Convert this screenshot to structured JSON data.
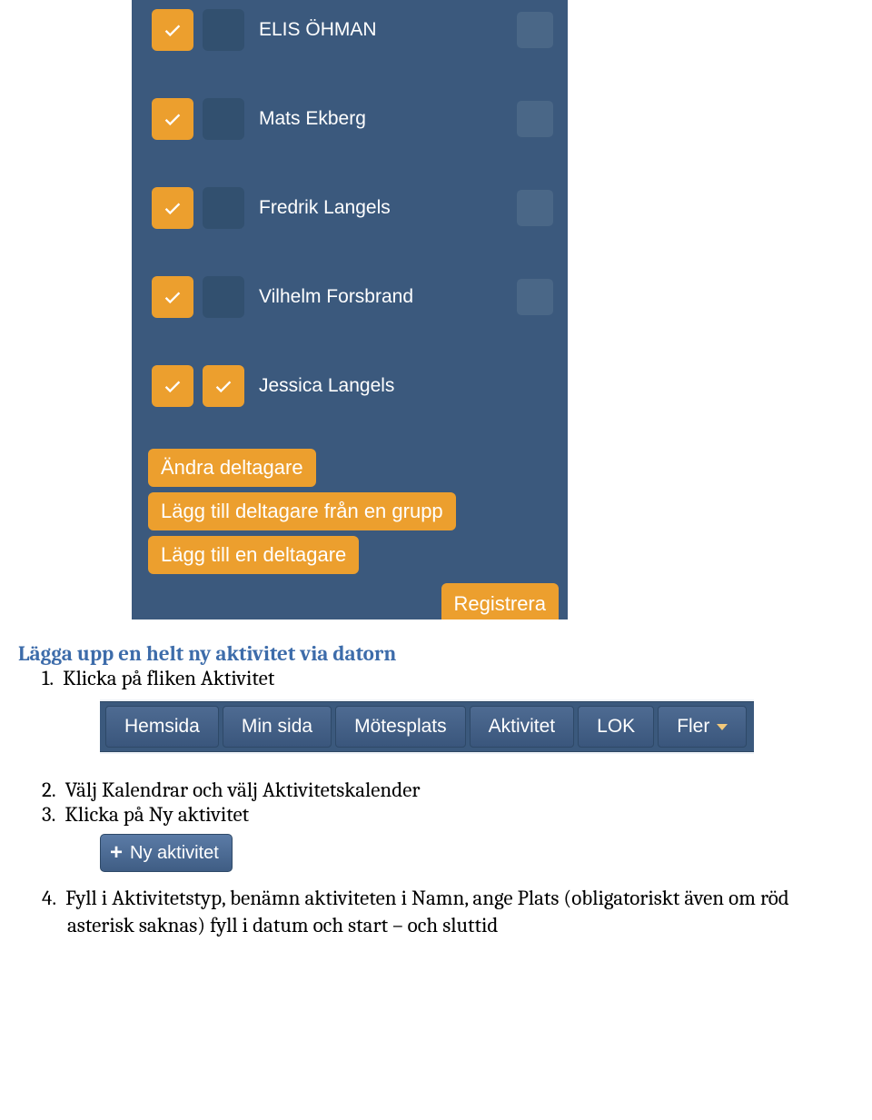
{
  "participants": [
    {
      "name": "ELIS ÖHMAN",
      "box1": true,
      "box2": false,
      "trailing": true
    },
    {
      "name": "Mats Ekberg",
      "box1": true,
      "box2": false,
      "trailing": true
    },
    {
      "name": "Fredrik Langels",
      "box1": true,
      "box2": false,
      "trailing": true
    },
    {
      "name": "Vilhelm Forsbrand",
      "box1": true,
      "box2": false,
      "trailing": true
    },
    {
      "name": "Jessica Langels",
      "box1": true,
      "box2": true,
      "trailing": false
    }
  ],
  "buttons": {
    "edit_participants": "Ändra deltagare",
    "add_from_group": "Lägg till deltagare från en grupp",
    "add_one": "Lägg till en deltagare",
    "register": "Registrera"
  },
  "section_heading": "Lägga upp en helt ny aktivitet via datorn",
  "steps": {
    "s1_num": "1.",
    "s1": "Klicka på fliken Aktivitet",
    "s2_num": "2.",
    "s2": "Välj Kalendrar och välj Aktivitetskalender",
    "s3_num": "3.",
    "s3": "Klicka på Ny aktivitet",
    "s4_num": "4.",
    "s4": "Fyll i Aktivitetstyp, benämn aktiviteten i Namn, ange Plats (obligatoriskt även om röd asterisk saknas) fyll i datum och start – och sluttid"
  },
  "tabs": {
    "hemsida": "Hemsida",
    "minsida": "Min sida",
    "motesplats": "Mötesplats",
    "aktivitet": "Aktivitet",
    "lok": "LOK",
    "fler": "Fler"
  },
  "ny_aktivitet": "Ny aktivitet"
}
